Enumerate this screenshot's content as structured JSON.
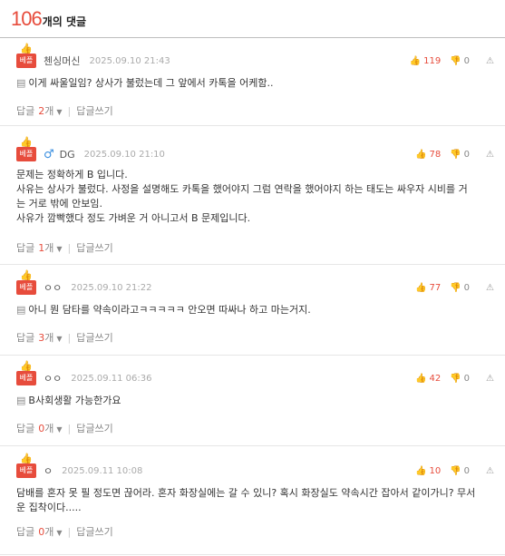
{
  "header": {
    "count": "106",
    "label": "개의 댓글"
  },
  "comments": [
    {
      "badge": "베플",
      "nick": "첸싱머신",
      "gender": "",
      "date": "2025.09.10 21:43",
      "up": "119",
      "down": "0",
      "body": "이게 싸울일임? 상사가 불렀는데 그 앞에서 카톡을 어케함..",
      "reply_label": "답글",
      "reply_count": "2",
      "reply_unit": "개",
      "write_label": "답글쓰기"
    },
    {
      "badge": "베플",
      "nick": "DG",
      "gender": "♂",
      "date": "2025.09.10 21:10",
      "up": "78",
      "down": "0",
      "body": "문제는 정확하게 B 입니다.\n사유는 상사가 불렀다. 사정을 설명해도 카톡을 했어야지 그럼 연락을 했어야지 하는 태도는 싸우자 시비를 거는 거로 밖에 안보임.\n사유가 깜빡했다 정도 가벼운 거 아니고서 B 문제입니다.",
      "reply_label": "답글",
      "reply_count": "1",
      "reply_unit": "개",
      "write_label": "답글쓰기"
    },
    {
      "badge": "베플",
      "nick": "ㅇㅇ",
      "gender": "",
      "date": "2025.09.10 21:22",
      "up": "77",
      "down": "0",
      "body": "아니 뭔 담타를 약속이라고ㅋㅋㅋㅋㅋ 안오면 따싸나 하고 마는거지.",
      "reply_label": "답글",
      "reply_count": "3",
      "reply_unit": "개",
      "write_label": "답글쓰기"
    },
    {
      "badge": "베플",
      "nick": "ㅇㅇ",
      "gender": "",
      "date": "2025.09.11 06:36",
      "up": "42",
      "down": "0",
      "body": "B사회생활 가능한가요",
      "reply_label": "답글",
      "reply_count": "0",
      "reply_unit": "개",
      "write_label": "답글쓰기"
    },
    {
      "badge": "베플",
      "nick": "ㅇ",
      "gender": "",
      "date": "2025.09.11 10:08",
      "up": "10",
      "down": "0",
      "body": "담배를 혼자 못 필 정도면 끊어라. 혼자 화장실에는 갈 수 있니? 혹시 화장실도 약속시간 잡아서 같이가니? 무서운 집착이다.....",
      "reply_label": "답글",
      "reply_count": "0",
      "reply_unit": "개",
      "write_label": "답글쓰기"
    }
  ],
  "icons": {
    "thumb_up": "thumb-up-icon",
    "thumb_down": "thumb-down-icon",
    "report": "siren-icon",
    "doc": "document-icon",
    "caret": "caret-down-icon"
  }
}
